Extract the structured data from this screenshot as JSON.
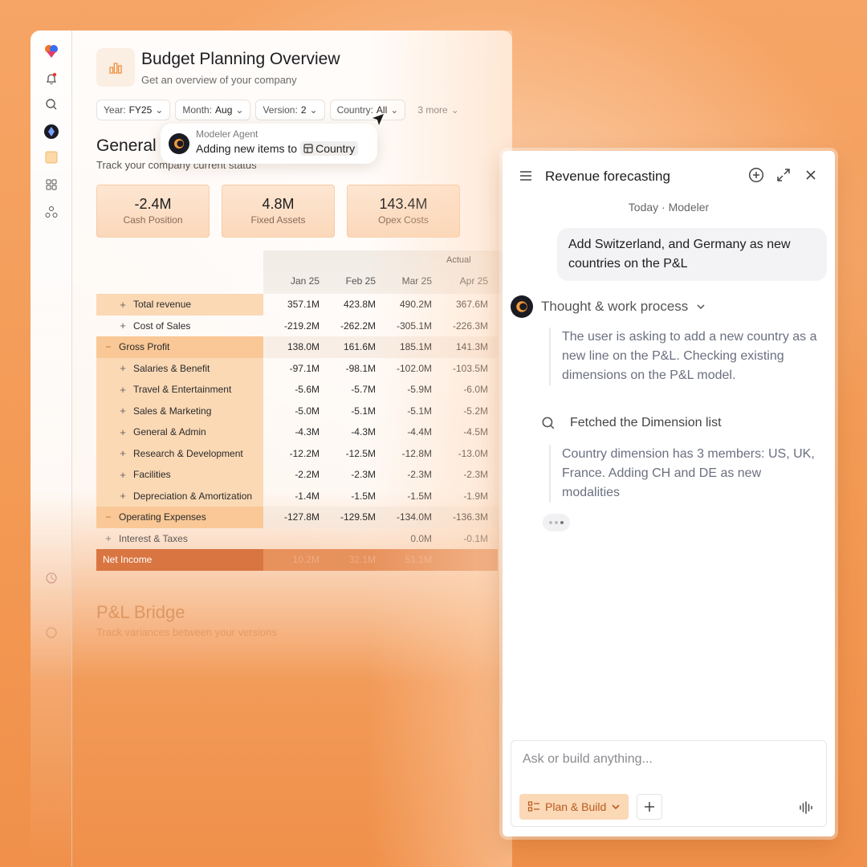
{
  "page": {
    "title": "Budget Planning Overview",
    "subtitle": "Get an overview of your company"
  },
  "filters": [
    {
      "label": "Year: ",
      "value": "FY25"
    },
    {
      "label": "Month: ",
      "value": "Aug"
    },
    {
      "label": "Version: ",
      "value": "2"
    },
    {
      "label": "Country: ",
      "value": "All"
    },
    {
      "label": "3 more",
      "value": ""
    }
  ],
  "agent_tip": {
    "name": "Modeler Agent",
    "message": "Adding new items to",
    "chip": "Country"
  },
  "general": {
    "title": "General",
    "subtitle": "Track your company current status"
  },
  "kpis": [
    {
      "value": "-2.4M",
      "label": "Cash Position"
    },
    {
      "value": "4.8M",
      "label": "Fixed Assets"
    },
    {
      "value": "143.4M",
      "label": "Opex Costs"
    }
  ],
  "pl": {
    "header_group": "Actual",
    "months": [
      "Jan 25",
      "Feb 25",
      "Mar 25",
      "Apr 25"
    ],
    "rows": [
      {
        "label": "Total revenue",
        "values": [
          "357.1M",
          "423.8M",
          "490.2M",
          "367.6M"
        ]
      },
      {
        "label": "Cost of Sales",
        "values": [
          "-219.2M",
          "-262.2M",
          "-305.1M",
          "-226.3M"
        ]
      },
      {
        "label": "Gross Profit",
        "values": [
          "138.0M",
          "161.6M",
          "185.1M",
          "141.3M"
        ]
      },
      {
        "label": "Salaries & Benefit",
        "values": [
          "-97.1M",
          "-98.1M",
          "-102.0M",
          "-103.5M"
        ]
      },
      {
        "label": "Travel & Entertainment",
        "values": [
          "-5.6M",
          "-5.7M",
          "-5.9M",
          "-6.0M"
        ]
      },
      {
        "label": "Sales & Marketing",
        "values": [
          "-5.0M",
          "-5.1M",
          "-5.1M",
          "-5.2M"
        ]
      },
      {
        "label": "General & Admin",
        "values": [
          "-4.3M",
          "-4.3M",
          "-4.4M",
          "-4.5M"
        ]
      },
      {
        "label": "Research & Development",
        "values": [
          "-12.2M",
          "-12.5M",
          "-12.8M",
          "-13.0M"
        ]
      },
      {
        "label": "Facilities",
        "values": [
          "-2.2M",
          "-2.3M",
          "-2.3M",
          "-2.3M"
        ]
      },
      {
        "label": "Depreciation & Amortization",
        "values": [
          "-1.4M",
          "-1.5M",
          "-1.5M",
          "-1.9M"
        ]
      },
      {
        "label": "Operating Expenses",
        "values": [
          "-127.8M",
          "-129.5M",
          "-134.0M",
          "-136.3M"
        ]
      },
      {
        "label": "Interest & Taxes",
        "values": [
          "",
          "",
          "0.0M",
          "-0.1M"
        ]
      },
      {
        "label": "Net Income",
        "values": [
          "10.2M",
          "32.1M",
          "51.1M",
          ""
        ]
      }
    ]
  },
  "bridge": {
    "title": "P&L Bridge",
    "subtitle": "Track variances between your versions"
  },
  "chat": {
    "title": "Revenue forecasting",
    "date": "Today · Modeler",
    "user_message": "Add Switzerland, and Germany as new countries on the P&L",
    "thought_label": "Thought & work process",
    "thought_text": "The user is asking to add a new country as a new line on the P&L. Checking existing dimensions on the P&L model.",
    "fetch_label": "Fetched the Dimension list",
    "result_text": "Country dimension has 3 members: US, UK, France. Adding CH and DE as new modalities",
    "composer_placeholder": "Ask or build anything...",
    "plan_button": "Plan & Build"
  },
  "colors": {
    "accent": "#f49a55",
    "highlight": "#f9c896",
    "net_income": "#d97540"
  }
}
